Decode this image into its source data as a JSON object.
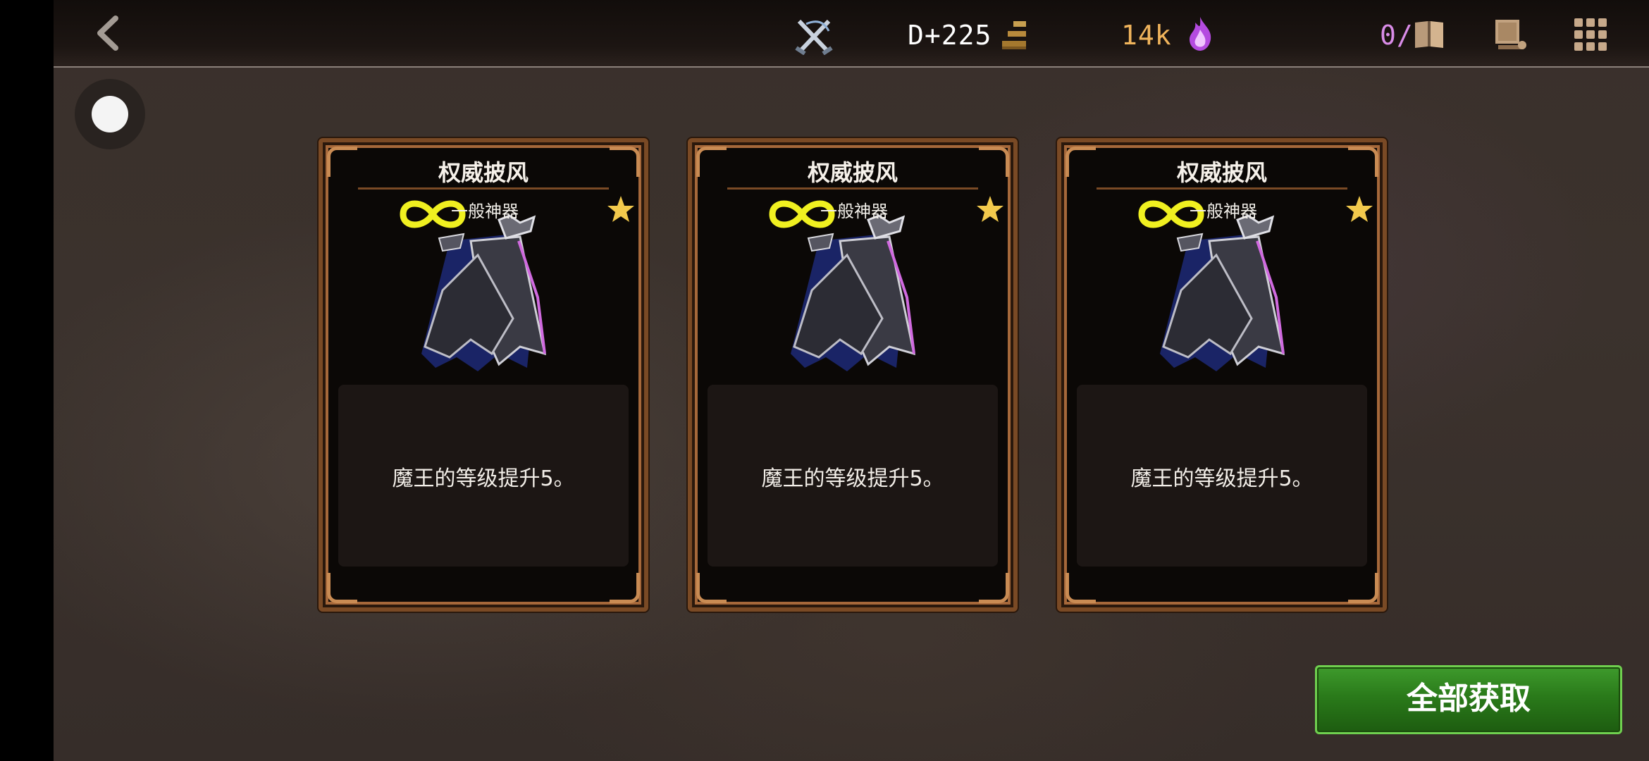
{
  "topbar": {
    "stage_label": "D+225",
    "currency_amount": "14k",
    "capacity": "0/0"
  },
  "cards": [
    {
      "title": "权威披风",
      "rarity": "一般神器",
      "description": "魔王的等级提升5。"
    },
    {
      "title": "权威披风",
      "rarity": "一般神器",
      "description": "魔王的等级提升5。"
    },
    {
      "title": "权威披风",
      "rarity": "一般神器",
      "description": "魔王的等级提升5。"
    }
  ],
  "actions": {
    "collect_all_label": "全部获取"
  },
  "colors": {
    "stage_text": "#ffffff",
    "currency_text": "#f0b45c",
    "capacity_text": "#d98ce8",
    "card_border": "#a6683a",
    "collect_button": "#2a7a1a"
  },
  "icons": [
    "back-icon",
    "battle-icon",
    "stairs-icon",
    "soul-flame-icon",
    "book-icon",
    "scroll-icon",
    "grid-menu-icon",
    "infinity-icon",
    "star-icon"
  ]
}
